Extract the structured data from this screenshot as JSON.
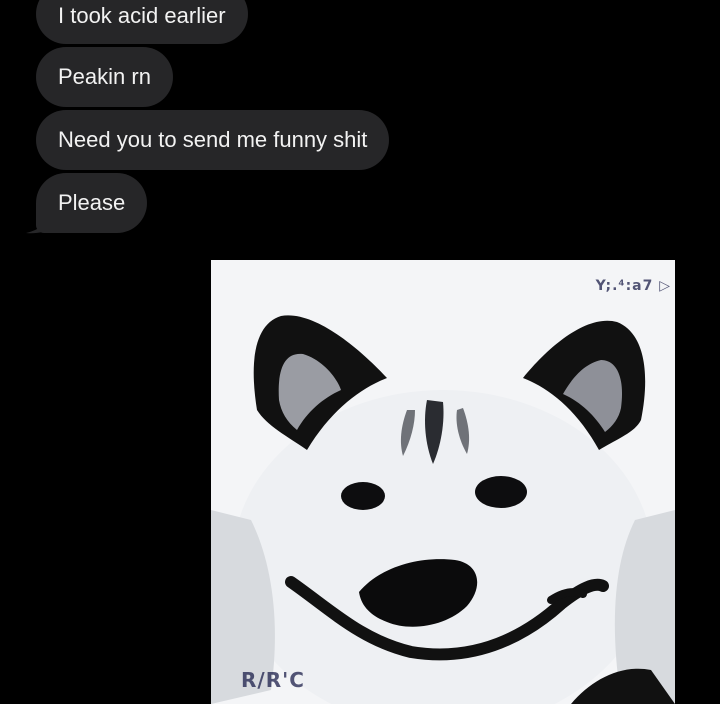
{
  "messages": [
    {
      "text": "I took acid earlier"
    },
    {
      "text": "Peakin rn"
    },
    {
      "text": "Need you to send me funny shit"
    },
    {
      "text": "Please"
    }
  ],
  "image_message": {
    "subject": "smiling dog",
    "top_corner_text": "Y;.⁴:a7 ▷",
    "bottom_corner_text": "R/R'C"
  },
  "colors": {
    "background": "#000000",
    "bubble": "#262628",
    "bubble_text": "#f2f2f2",
    "image_background": "#f4f5f7"
  }
}
